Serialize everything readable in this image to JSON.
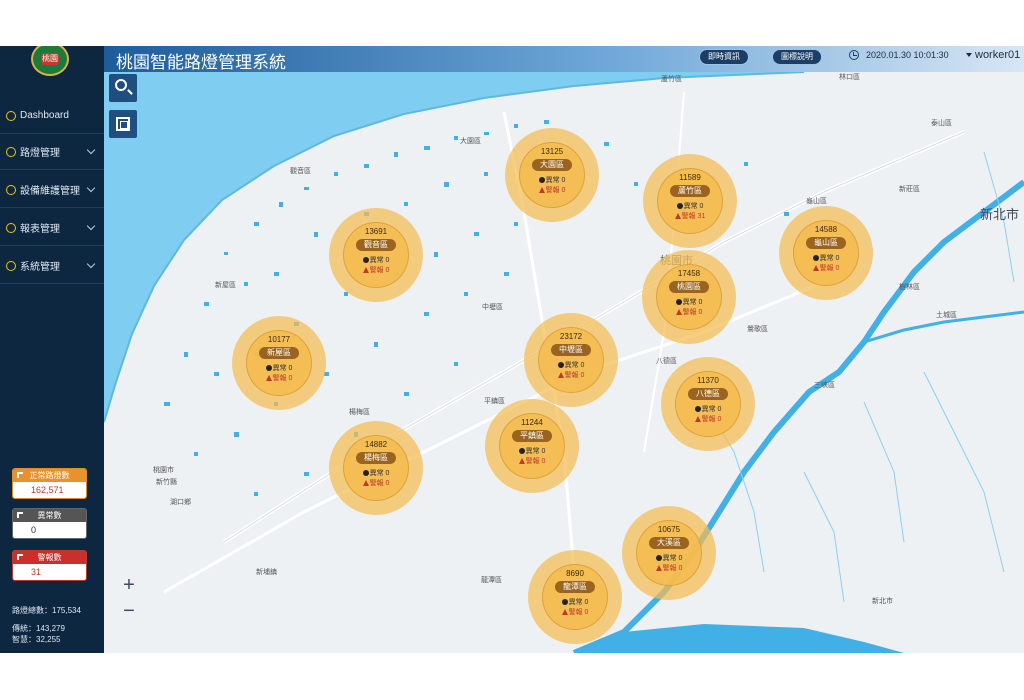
{
  "app": {
    "title": "桃園智能路燈管理系統",
    "logo_text": "桃園"
  },
  "header": {
    "realtime_label": "即時資訊",
    "legend_label": "圖標說明",
    "datetime": "2020.01.30 10:01:30",
    "user": "worker01"
  },
  "sidebar": {
    "items": [
      {
        "label": "Dashboard",
        "icon": "home-icon",
        "has_submenu": false
      },
      {
        "label": "路燈管理",
        "icon": "light-icon",
        "has_submenu": true
      },
      {
        "label": "設備維護管理",
        "icon": "gear-icon",
        "has_submenu": true
      },
      {
        "label": "報表管理",
        "icon": "chart-icon",
        "has_submenu": true
      },
      {
        "label": "系統管理",
        "icon": "user-icon",
        "has_submenu": true
      }
    ],
    "stats": {
      "normal": {
        "label": "正常路燈數",
        "value": "162,571",
        "color": "#e8922e"
      },
      "abnormal": {
        "label": "異常數",
        "value": "0",
        "color": "#555555"
      },
      "alarm": {
        "label": "警報數",
        "value": "31",
        "color": "#c9302c"
      }
    },
    "totals": {
      "total": "路燈總數：175,534",
      "traditional": "傳統：143,279",
      "smart": "智慧：32,255"
    }
  },
  "map": {
    "places": [
      {
        "name": "蘆竹區",
        "class": ""
      },
      {
        "name": "林口區",
        "class": ""
      },
      {
        "name": "大園區",
        "class": ""
      },
      {
        "name": "觀音區",
        "class": ""
      },
      {
        "name": "泰山區",
        "class": ""
      },
      {
        "name": "新莊區",
        "class": ""
      },
      {
        "name": "龜山區",
        "class": ""
      },
      {
        "name": "新北市",
        "class": "big"
      },
      {
        "name": "桃園市",
        "class": "mid"
      },
      {
        "name": "新屋區",
        "class": ""
      },
      {
        "name": "中壢區",
        "class": ""
      },
      {
        "name": "樹林區",
        "class": ""
      },
      {
        "name": "土城區",
        "class": ""
      },
      {
        "name": "鶯歌區",
        "class": ""
      },
      {
        "name": "八德區",
        "class": ""
      },
      {
        "name": "三峽區",
        "class": ""
      },
      {
        "name": "平鎮區",
        "class": ""
      },
      {
        "name": "楊梅區",
        "class": ""
      },
      {
        "name": "桃園市",
        "class": ""
      },
      {
        "name": "新竹縣",
        "class": ""
      },
      {
        "name": "湖口鄉",
        "class": ""
      },
      {
        "name": "新埔鎮",
        "class": ""
      },
      {
        "name": "龍潭區",
        "class": ""
      },
      {
        "name": "新北市",
        "class": ""
      }
    ],
    "clusters": [
      {
        "count": "13125",
        "name": "大園區",
        "abnormal": "異常 0",
        "alarm": "警報 0"
      },
      {
        "count": "11589",
        "name": "蘆竹區",
        "abnormal": "異常 0",
        "alarm": "警報 31"
      },
      {
        "count": "13691",
        "name": "觀音區",
        "abnormal": "異常 0",
        "alarm": "警報 0"
      },
      {
        "count": "14588",
        "name": "龜山區",
        "abnormal": "異常 0",
        "alarm": "警報 0"
      },
      {
        "count": "17458",
        "name": "桃園區",
        "abnormal": "異常 0",
        "alarm": "警報 0"
      },
      {
        "count": "10177",
        "name": "新屋區",
        "abnormal": "異常 0",
        "alarm": "警報 0"
      },
      {
        "count": "23172",
        "name": "中壢區",
        "abnormal": "異常 0",
        "alarm": "警報 0"
      },
      {
        "count": "11370",
        "name": "八德區",
        "abnormal": "異常 0",
        "alarm": "警報 0"
      },
      {
        "count": "11244",
        "name": "平鎮區",
        "abnormal": "異常 0",
        "alarm": "警報 0"
      },
      {
        "count": "14882",
        "name": "楊梅區",
        "abnormal": "異常 0",
        "alarm": "警報 0"
      },
      {
        "count": "10675",
        "name": "大溪區",
        "abnormal": "異常 0",
        "alarm": "警報 0"
      },
      {
        "count": "8690",
        "name": "龍潭區",
        "abnormal": "異常 0",
        "alarm": "警報 0"
      }
    ]
  },
  "colors": {
    "sidebar_bg": "#0d2740",
    "cluster_fill": "#f4bc50",
    "water": "#41b0e6",
    "sea": "#7fcdf0"
  }
}
